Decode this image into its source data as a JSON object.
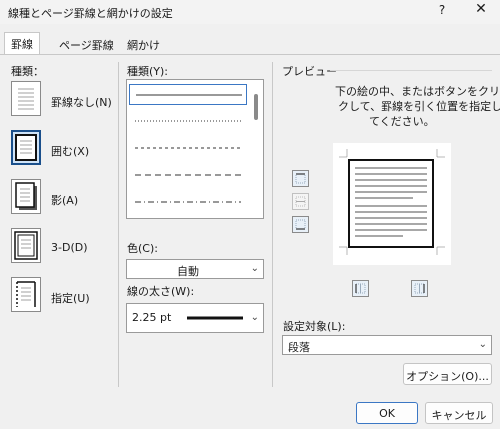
{
  "dialog": {
    "title": "線種とページ罫線と網かけの設定",
    "help_label": "?",
    "close_label": "✕"
  },
  "tabs": [
    {
      "label": "罫線",
      "active": true
    },
    {
      "label": "ページ罫線",
      "active": false
    },
    {
      "label": "網かけ",
      "active": false
    }
  ],
  "settings": {
    "header": "種類：",
    "items": [
      {
        "label": "罫線なし(N)",
        "selected": false
      },
      {
        "label": "囲む(X)",
        "selected": true
      },
      {
        "label": "影(A)",
        "selected": false
      },
      {
        "label": "3-D(D)",
        "selected": false
      },
      {
        "label": "指定(U)",
        "selected": false
      }
    ]
  },
  "style": {
    "header": "種類(Y):",
    "selected_index": 0,
    "items": [
      "solid",
      "dotted",
      "dashed",
      "dash-long",
      "dash-dot"
    ]
  },
  "color": {
    "label": "色(C):",
    "value": "自動"
  },
  "width": {
    "label": "線の太さ(W):",
    "value": "2.25 pt"
  },
  "preview": {
    "header": "プレビュー",
    "instruction_lines": [
      "下の絵の中、またはボタンをクリッ",
      "クして、罫線を引く位置を指定し",
      "てください。"
    ]
  },
  "apply_to": {
    "label": "設定対象(L):",
    "value": "段落"
  },
  "buttons": {
    "options": "オプション(O)...",
    "ok": "OK",
    "cancel": "キャンセル"
  },
  "colors": {
    "accent": "#3b77c4",
    "selected_fill": "#cfe3f7",
    "dialog_bg": "#f0f0f0"
  }
}
